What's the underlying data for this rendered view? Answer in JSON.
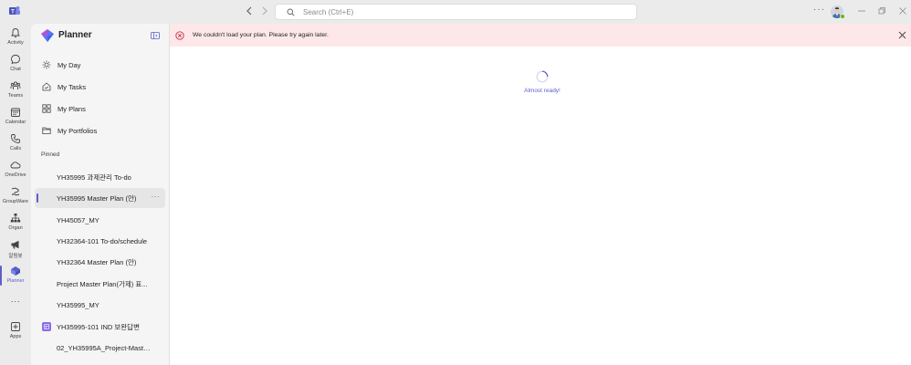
{
  "titlebar": {
    "search_placeholder": "Search (Ctrl+E)",
    "more_label": "···"
  },
  "rail": {
    "items": [
      {
        "label": "Activity",
        "icon": "bell-icon"
      },
      {
        "label": "Chat",
        "icon": "chat-icon"
      },
      {
        "label": "Teams",
        "icon": "teams-icon"
      },
      {
        "label": "Calendar",
        "icon": "calendar-icon"
      },
      {
        "label": "Calls",
        "icon": "phone-icon"
      },
      {
        "label": "OneDrive",
        "icon": "cloud-icon"
      },
      {
        "label": "GroupWare",
        "icon": "groupware-icon"
      },
      {
        "label": "Organ",
        "icon": "org-chart-icon"
      },
      {
        "label": "알림봇",
        "icon": "megaphone-icon"
      },
      {
        "label": "Planner",
        "icon": "planner-icon"
      },
      {
        "label": "···",
        "icon": "more-icon"
      },
      {
        "label": "Apps",
        "icon": "apps-icon"
      }
    ],
    "active": "Planner"
  },
  "sidebar": {
    "title": "Planner",
    "nav": [
      {
        "label": "My Day",
        "icon": "sun-icon"
      },
      {
        "label": "My Tasks",
        "icon": "home-check-icon"
      },
      {
        "label": "My Plans",
        "icon": "grid-icon"
      },
      {
        "label": "My Portfolios",
        "icon": "folder-icon"
      }
    ],
    "pinned_label": "Pinned",
    "pinned": [
      {
        "label": "YH35995 과제관리 To-do"
      },
      {
        "label": "YH35995 Master Plan (안)",
        "selected": true
      },
      {
        "label": "YH45057_MY"
      },
      {
        "label": "YH32364-101 To-do/schedule"
      },
      {
        "label": "YH32364 Master Plan (안)"
      },
      {
        "label": "Project Master Plan(가제) 표..."
      },
      {
        "label": "YH35995_MY"
      },
      {
        "label": "YH35995-101 IND 보완답변",
        "badge": true
      },
      {
        "label": "02_YH35995A_Project-Maste..."
      }
    ],
    "pin_more": "···"
  },
  "main": {
    "error_message": "We couldn't load your plan. Please try again later.",
    "loading_text": "Almost ready!"
  },
  "colors": {
    "accent": "#5b5fc7",
    "error_bg": "#fde7e9",
    "error_icon": "#c4314b"
  }
}
